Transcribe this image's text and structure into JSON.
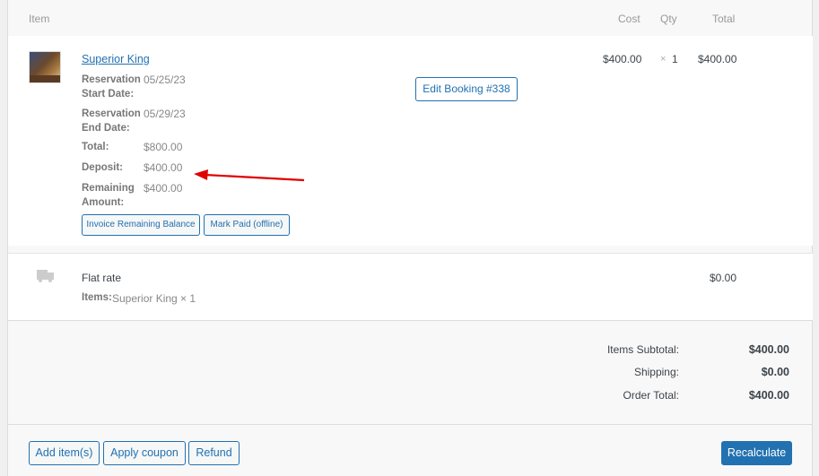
{
  "header": {
    "item": "Item",
    "cost": "Cost",
    "qty": "Qty",
    "total": "Total"
  },
  "line_item": {
    "name": "Superior King",
    "thumbnail_text": "Superior King",
    "cost": "$400.00",
    "qty_prefix": "×",
    "qty": "1",
    "total": "$400.00",
    "meta": [
      {
        "label": "Reservation Start Date:",
        "value": "05/25/23"
      },
      {
        "label": "Reservation End Date:",
        "value": "05/29/23"
      },
      {
        "label": "Total:",
        "value": "$800.00"
      },
      {
        "label": "Deposit:",
        "value": "$400.00"
      },
      {
        "label": "Remaining Amount:",
        "value": "$400.00"
      }
    ],
    "edit_booking": "Edit Booking #338",
    "invoice_button": "Invoice Remaining Balance",
    "mark_paid_button": "Mark Paid (offline)"
  },
  "shipping": {
    "name": "Flat rate",
    "items_label": "Items:",
    "items_value": "Superior King × 1",
    "total": "$0.00",
    "icon": "truck-icon"
  },
  "totals": [
    {
      "label": "Items Subtotal:",
      "value": "$400.00"
    },
    {
      "label": "Shipping:",
      "value": "$0.00"
    },
    {
      "label": "Order Total:",
      "value": "$400.00"
    }
  ],
  "actions": {
    "add_items": "Add item(s)",
    "apply_coupon": "Apply coupon",
    "refund": "Refund",
    "recalculate": "Recalculate"
  },
  "colors": {
    "accent": "#2271b1",
    "annotation_arrow": "#e00000"
  }
}
